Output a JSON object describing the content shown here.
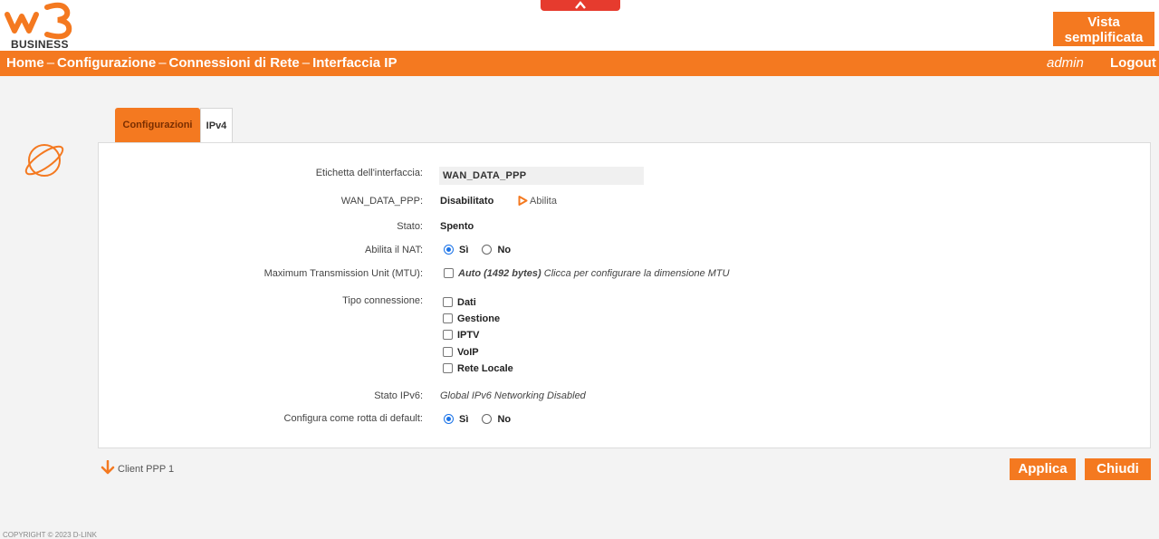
{
  "header": {
    "logo_text": "BUSINESS",
    "simple_view_label": "Vista semplificata"
  },
  "nav": {
    "breadcrumb": [
      "Home",
      "Configurazione",
      "Connessioni di Rete",
      "Interfaccia IP"
    ],
    "separator": "–",
    "user": "admin",
    "logout_label": "Logout"
  },
  "tabs": [
    {
      "label": "Configurazioni",
      "active": true
    },
    {
      "label": "IPv4",
      "active": false
    }
  ],
  "form": {
    "interface_label": {
      "label": "Etichetta dell'interfaccia:",
      "value": "WAN_DATA_PPP"
    },
    "status_row": {
      "label": "WAN_DATA_PPP:",
      "value": "Disabilitato",
      "action": "Abilita"
    },
    "state": {
      "label": "Stato:",
      "value": "Spento"
    },
    "nat": {
      "label": "Abilita il NAT:",
      "yes": "Sì",
      "no": "No",
      "selected": "yes"
    },
    "mtu": {
      "label": "Maximum Transmission Unit (MTU):",
      "auto": "Auto (1492 bytes)",
      "hint": "Clicca per configurare la dimensione MTU"
    },
    "connection_type": {
      "label": "Tipo connessione:",
      "options": [
        "Dati",
        "Gestione",
        "IPTV",
        "VoIP",
        "Rete Locale"
      ]
    },
    "ipv6_state": {
      "label": "Stato IPv6:",
      "value": "Global IPv6 Networking Disabled"
    },
    "default_route": {
      "label": "Configura come rotta di default:",
      "yes": "Sì",
      "no": "No",
      "selected": "yes"
    }
  },
  "footer": {
    "client_link": "Client PPP 1",
    "apply_label": "Applica",
    "close_label": "Chiudi",
    "copyright": "COPYRIGHT © 2023 D-LINK"
  },
  "colors": {
    "accent": "#f47920",
    "radio": "#1a73e8",
    "top_tab": "#e63b2e"
  }
}
